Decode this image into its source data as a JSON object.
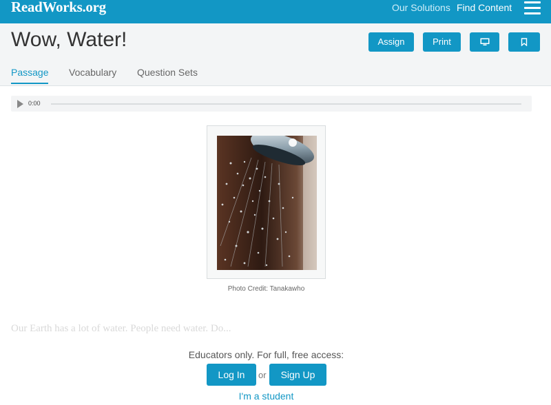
{
  "topbar": {
    "logo": "ReadWorks.org",
    "nav": [
      "Our Solutions",
      "Find Content"
    ],
    "menu_icon": "hamburger-icon"
  },
  "header": {
    "title": "Wow, Water!",
    "buttons": {
      "assign": "Assign",
      "print": "Print",
      "present_icon": "monitor-icon",
      "bookmark_icon": "bookmark-icon"
    },
    "tabs": [
      {
        "label": "Passage",
        "active": true
      },
      {
        "label": "Vocabulary",
        "active": false
      },
      {
        "label": "Question Sets",
        "active": false
      }
    ]
  },
  "audio": {
    "play_icon": "play-icon",
    "time": "0:00",
    "progress": 0
  },
  "passage": {
    "image_subject": "water spraying from a shower head",
    "caption": "Photo Credit: Tanakawho",
    "preview_text": "Our Earth has a lot of water. People need water. Do..."
  },
  "access": {
    "prompt": "Educators only. For full, free access:",
    "login": "Log In",
    "or": "or",
    "signup": "Sign Up",
    "student": "I'm a student"
  },
  "colors": {
    "brand": "#1297c5",
    "header_bg": "#f3f5f6"
  }
}
